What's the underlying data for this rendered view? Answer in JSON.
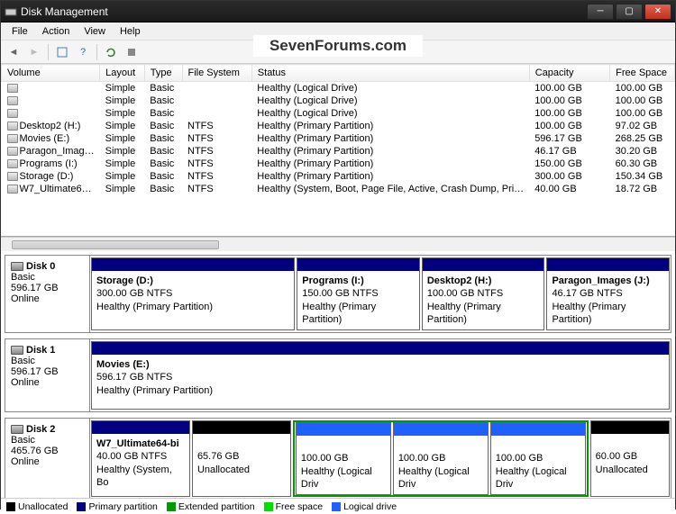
{
  "window": {
    "title": "Disk Management"
  },
  "menu": {
    "file": "File",
    "action": "Action",
    "view": "View",
    "help": "Help"
  },
  "watermark": "SevenForums.com",
  "columns": {
    "volume": "Volume",
    "layout": "Layout",
    "type": "Type",
    "fs": "File System",
    "status": "Status",
    "capacity": "Capacity",
    "free": "Free Space"
  },
  "volumes": [
    {
      "name": "",
      "layout": "Simple",
      "type": "Basic",
      "fs": "",
      "status": "Healthy (Logical Drive)",
      "capacity": "100.00 GB",
      "free": "100.00 GB"
    },
    {
      "name": "",
      "layout": "Simple",
      "type": "Basic",
      "fs": "",
      "status": "Healthy (Logical Drive)",
      "capacity": "100.00 GB",
      "free": "100.00 GB"
    },
    {
      "name": "",
      "layout": "Simple",
      "type": "Basic",
      "fs": "",
      "status": "Healthy (Logical Drive)",
      "capacity": "100.00 GB",
      "free": "100.00 GB"
    },
    {
      "name": "Desktop2 (H:)",
      "layout": "Simple",
      "type": "Basic",
      "fs": "NTFS",
      "status": "Healthy (Primary Partition)",
      "capacity": "100.00 GB",
      "free": "97.02 GB"
    },
    {
      "name": "Movies (E:)",
      "layout": "Simple",
      "type": "Basic",
      "fs": "NTFS",
      "status": "Healthy (Primary Partition)",
      "capacity": "596.17 GB",
      "free": "268.25 GB"
    },
    {
      "name": "Paragon_Imag…",
      "layout": "Simple",
      "type": "Basic",
      "fs": "NTFS",
      "status": "Healthy (Primary Partition)",
      "capacity": "46.17 GB",
      "free": "30.20 GB"
    },
    {
      "name": "Programs (I:)",
      "layout": "Simple",
      "type": "Basic",
      "fs": "NTFS",
      "status": "Healthy (Primary Partition)",
      "capacity": "150.00 GB",
      "free": "60.30 GB"
    },
    {
      "name": "Storage (D:)",
      "layout": "Simple",
      "type": "Basic",
      "fs": "NTFS",
      "status": "Healthy (Primary Partition)",
      "capacity": "300.00 GB",
      "free": "150.34 GB"
    },
    {
      "name": "W7_Ultimate6…",
      "layout": "Simple",
      "type": "Basic",
      "fs": "NTFS",
      "status": "Healthy (System, Boot, Page File, Active, Crash Dump, Pri…",
      "capacity": "40.00 GB",
      "free": "18.72 GB"
    }
  ],
  "disks": [
    {
      "name": "Disk 0",
      "type": "Basic",
      "size": "596.17 GB",
      "state": "Online",
      "parts": [
        {
          "label": "Storage  (D:)",
          "sub": "300.00 GB NTFS",
          "status": "Healthy (Primary Partition)",
          "kind": "primary",
          "flex": 2
        },
        {
          "label": "Programs  (I:)",
          "sub": "150.00 GB NTFS",
          "status": "Healthy (Primary Partition)",
          "kind": "primary",
          "flex": 1.2
        },
        {
          "label": "Desktop2  (H:)",
          "sub": "100.00 GB NTFS",
          "status": "Healthy (Primary Partition)",
          "kind": "primary",
          "flex": 1.2
        },
        {
          "label": "Paragon_Images  (J:)",
          "sub": "46.17 GB NTFS",
          "status": "Healthy (Primary Partition)",
          "kind": "primary",
          "flex": 1.2
        }
      ]
    },
    {
      "name": "Disk 1",
      "type": "Basic",
      "size": "596.17 GB",
      "state": "Online",
      "parts": [
        {
          "label": "Movies  (E:)",
          "sub": "596.17 GB NTFS",
          "status": "Healthy (Primary Partition)",
          "kind": "primary",
          "flex": 1
        }
      ]
    },
    {
      "name": "Disk 2",
      "type": "Basic",
      "size": "465.76 GB",
      "state": "Online",
      "parts": [
        {
          "label": "W7_Ultimate64-bi",
          "sub": "40.00 GB NTFS",
          "status": "Healthy (System, Bo",
          "kind": "primary",
          "flex": 1
        },
        {
          "label": "",
          "sub": "65.76 GB",
          "status": "Unallocated",
          "kind": "unalloc",
          "flex": 1
        },
        {
          "label": "",
          "sub": "100.00 GB",
          "status": "Healthy (Logical Driv",
          "kind": "logical",
          "flex": 1,
          "ext": true
        },
        {
          "label": "",
          "sub": "100.00 GB",
          "status": "Healthy (Logical Driv",
          "kind": "logical",
          "flex": 1,
          "ext": true
        },
        {
          "label": "",
          "sub": "100.00 GB",
          "status": "Healthy (Logical Driv",
          "kind": "logical",
          "flex": 1,
          "ext": true
        },
        {
          "label": "",
          "sub": "60.00 GB",
          "status": "Unallocated",
          "kind": "unalloc",
          "flex": 0.8
        }
      ]
    }
  ],
  "legend": {
    "unallocated": "Unallocated",
    "primary": "Primary partition",
    "extended": "Extended partition",
    "free": "Free space",
    "logical": "Logical drive"
  }
}
